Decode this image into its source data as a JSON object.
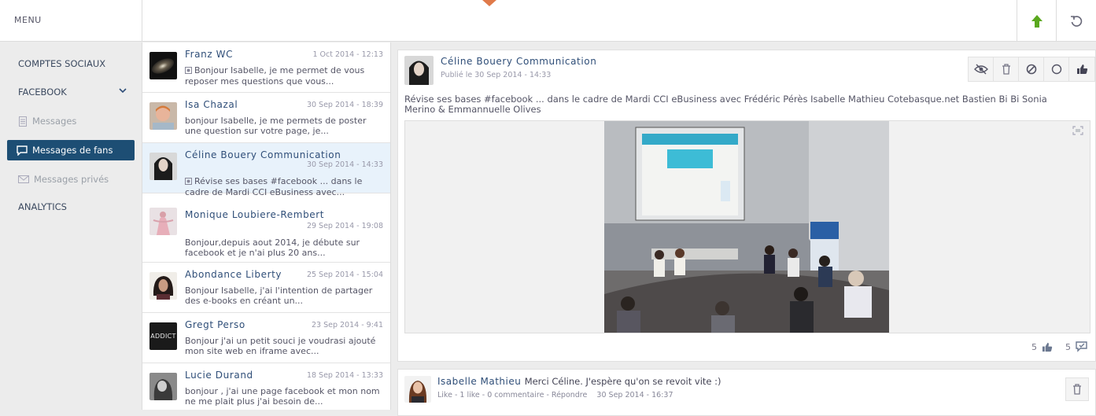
{
  "topbar": {
    "menu_label": "MENU"
  },
  "sidebar": {
    "items": [
      {
        "label": "COMPTES SOCIAUX"
      },
      {
        "label": "FACEBOOK"
      },
      {
        "label": "Messages"
      },
      {
        "label": "Messages de fans"
      },
      {
        "label": "Messages privés"
      },
      {
        "label": "ANALYTICS"
      }
    ]
  },
  "list": {
    "rows": [
      {
        "name": "Franz WC",
        "date": "1 Oct 2014 - 12:13",
        "snippet": "Bonjour Isabelle, je me permet de vous reposer mes questions que vous..."
      },
      {
        "name": "Isa Chazal",
        "date": "30 Sep 2014 - 18:39",
        "snippet": "bonjour Isabelle, je me permets de poster une question sur votre page, je..."
      },
      {
        "name": "Céline Bouery Communication",
        "date": "30 Sep 2014 - 14:33",
        "snippet": "Révise ses bases #facebook ... dans le cadre de Mardi CCI eBusiness avec..."
      },
      {
        "name": "Monique Loubiere-Rembert",
        "date": "29 Sep 2014 - 19:08",
        "snippet": "Bonjour,depuis aout 2014, je débute sur facebook et je n'ai plus 20 ans..."
      },
      {
        "name": "Abondance Liberty",
        "date": "25 Sep 2014 - 15:04",
        "snippet": "Bonjour Isabelle, j'ai l'intention de partager des e-books en créant un..."
      },
      {
        "name": "Gregt Perso",
        "date": "23 Sep 2014 - 9:41",
        "snippet": "Bonjour j'ai un petit souci je voudrasi ajouté mon site web en iframe avec...",
        "avatar_text": "ADDICT"
      },
      {
        "name": "Lucie Durand",
        "date": "18 Sep 2014 - 13:33",
        "snippet": "bonjour , j'ai une page facebook et mon nom ne me plait plus j'ai besoin de..."
      }
    ]
  },
  "post": {
    "author": "Céline Bouery Communication",
    "meta": "Publié le 30 Sep 2014 - 14:33",
    "text": "Révise ses bases #facebook ... dans le cadre de Mardi CCI eBusiness avec Frédéric Pérès Isabelle Mathieu Cotebasque.net Bastien Bi Bi Sonia Merino & Emmannuelle Olives",
    "likes": "5",
    "comments": "5"
  },
  "comment": {
    "author": "Isabelle Mathieu",
    "text": "Merci Céline. J'espère qu'on se revoit vite :)",
    "meta": "Like - 1 like - 0 commentaire - Répondre    30 Sep 2014 - 16:37"
  },
  "colors": {
    "accent": "#1d4e74",
    "upload": "#5aa81e",
    "notch": "#e07a4a",
    "link": "#2f4e78"
  }
}
